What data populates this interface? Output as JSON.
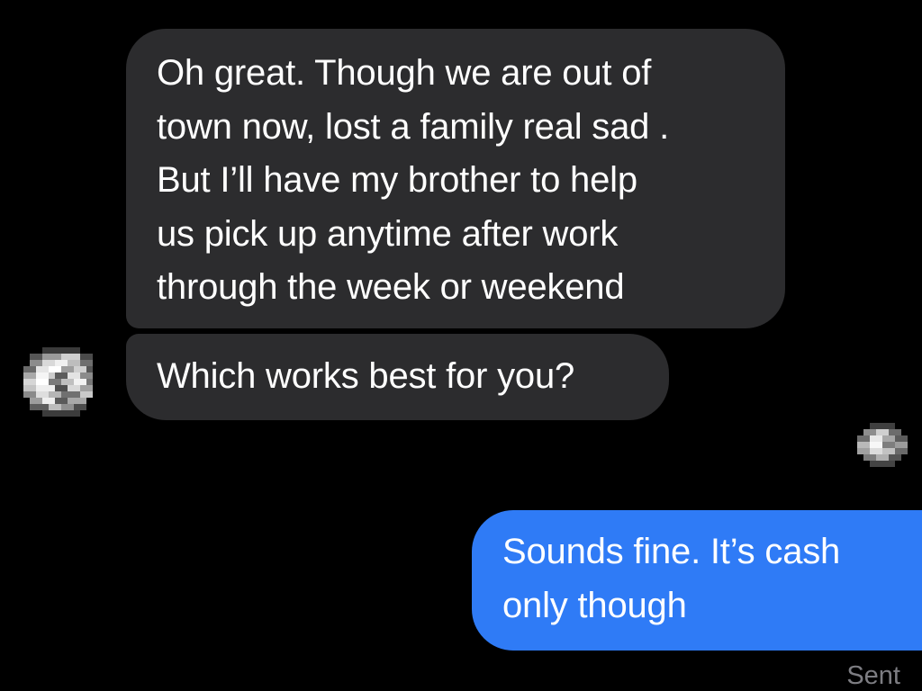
{
  "conversation": {
    "messages": [
      {
        "direction": "incoming",
        "lines": [
          "Oh great. Though we are out of",
          "town now, lost a family real sad .",
          "But I’ll have my brother to help",
          "us pick up anytime after work",
          "through the week or weekend"
        ]
      },
      {
        "direction": "incoming",
        "lines": [
          "Which works best for you?"
        ]
      },
      {
        "direction": "outgoing",
        "lines": [
          "Sounds fine. It’s cash",
          "only though"
        ]
      }
    ],
    "status": "Sent"
  },
  "colors": {
    "background": "#000000",
    "incoming_bubble": "#2c2c2e",
    "outgoing_bubble": "#2f7bf6",
    "status_text": "#7d7d82"
  },
  "icons": {
    "contact_avatar": "pixelated-avatar-icon",
    "read_receipt_avatar": "pixelated-avatar-icon"
  }
}
